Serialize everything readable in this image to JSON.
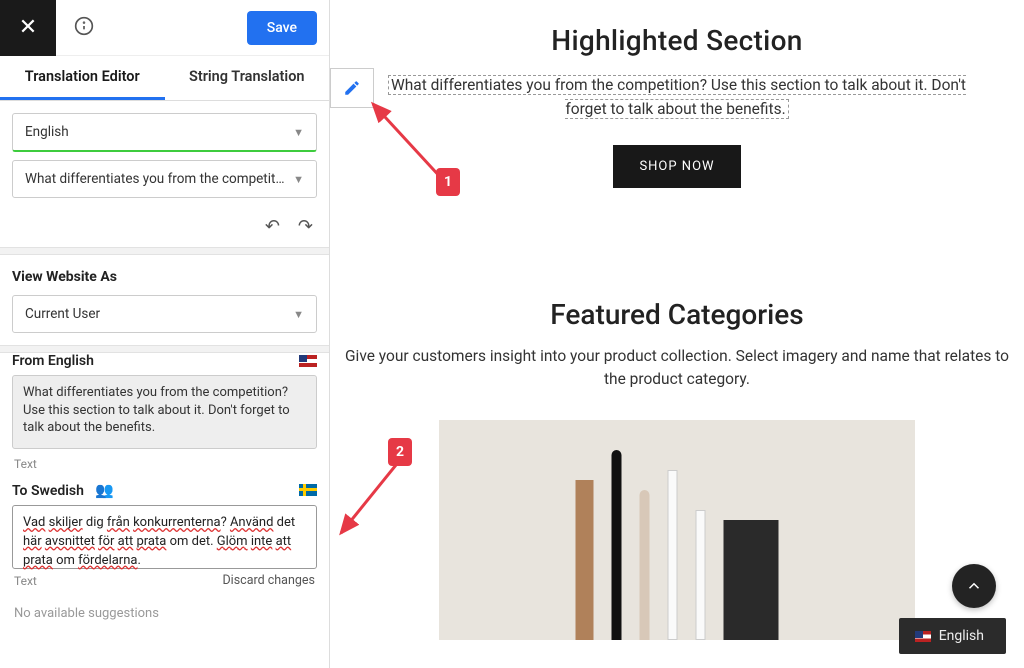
{
  "topbar": {
    "save_label": "Save"
  },
  "tabs": {
    "translation_editor": "Translation Editor",
    "string_translation": "String Translation"
  },
  "lang_select": {
    "value": "English"
  },
  "source_string_select": {
    "value": "What differentiates you from the competition? Use…"
  },
  "view_as": {
    "title": "View Website As",
    "value": "Current User"
  },
  "from": {
    "label": "From English",
    "text": "What differentiates you from the competition? Use this section to talk about it. Don't forget to talk about the benefits.",
    "type_hint": "Text"
  },
  "to": {
    "label": "To Swedish",
    "text": "Vad skiljer dig från konkurrenterna? Använd det här avsnittet för att prata om det. Glöm inte att prata om fördelarna.",
    "type_hint": "Text",
    "discard": "Discard changes"
  },
  "no_suggestions": "No available suggestions",
  "preview": {
    "highlighted_title": "Highlighted Section",
    "highlighted_desc": "What differentiates you from the competition? Use this section to talk about it. Don't forget to talk about the benefits.",
    "shop_now": "SHOP NOW",
    "featured_title": "Featured Categories",
    "featured_desc": "Give your customers insight into your product collection. Select imagery and name that relates to the product category."
  },
  "annotations": {
    "step1": "1",
    "step2": "2"
  },
  "switcher": {
    "label": "English"
  }
}
